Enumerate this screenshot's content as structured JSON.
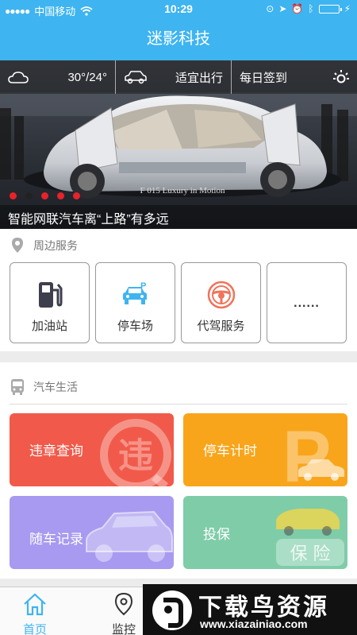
{
  "status_bar": {
    "signal": "●●●●●",
    "carrier": "中国移动",
    "time": "10:29",
    "battery_level": 0.95
  },
  "nav": {
    "title": "迷影科技"
  },
  "banner": {
    "weather": "30°/24°",
    "travel": "适宜出行",
    "checkin": "每日签到",
    "caption": "智能网联汽车离“上路”有多远",
    "plate_text": "F 015 Luxury in Motion",
    "active_dot": 0
  },
  "nearby": {
    "title": "周边服务",
    "items": [
      {
        "label": "加油站",
        "icon": "gas-station-icon"
      },
      {
        "label": "停车场",
        "icon": "parking-car-icon"
      },
      {
        "label": "代驾服务",
        "icon": "steering-wheel-icon"
      },
      {
        "label": "......",
        "icon": "more-icon"
      }
    ]
  },
  "car_life": {
    "title": "汽车生活",
    "cards": [
      {
        "label": "违章查询",
        "color": "#f15a4a",
        "watermark": "违"
      },
      {
        "label": "停车计时",
        "color": "#f9a51b",
        "watermark": "P"
      },
      {
        "label": "随车记录",
        "color": "#a79af0",
        "watermark": "car"
      },
      {
        "label": "投保",
        "color": "#7fcca9",
        "watermark": "保 险"
      }
    ]
  },
  "tabs": [
    {
      "label": "首页",
      "icon": "home-icon",
      "active": true
    },
    {
      "label": "监控",
      "icon": "location-pin-icon",
      "active": false
    }
  ],
  "watermark": {
    "title": "下载鸟资源",
    "url": "www.xiazainiao.com"
  },
  "colors": {
    "primary": "#3eb4f0",
    "active_tab": "#3eb4f0"
  }
}
